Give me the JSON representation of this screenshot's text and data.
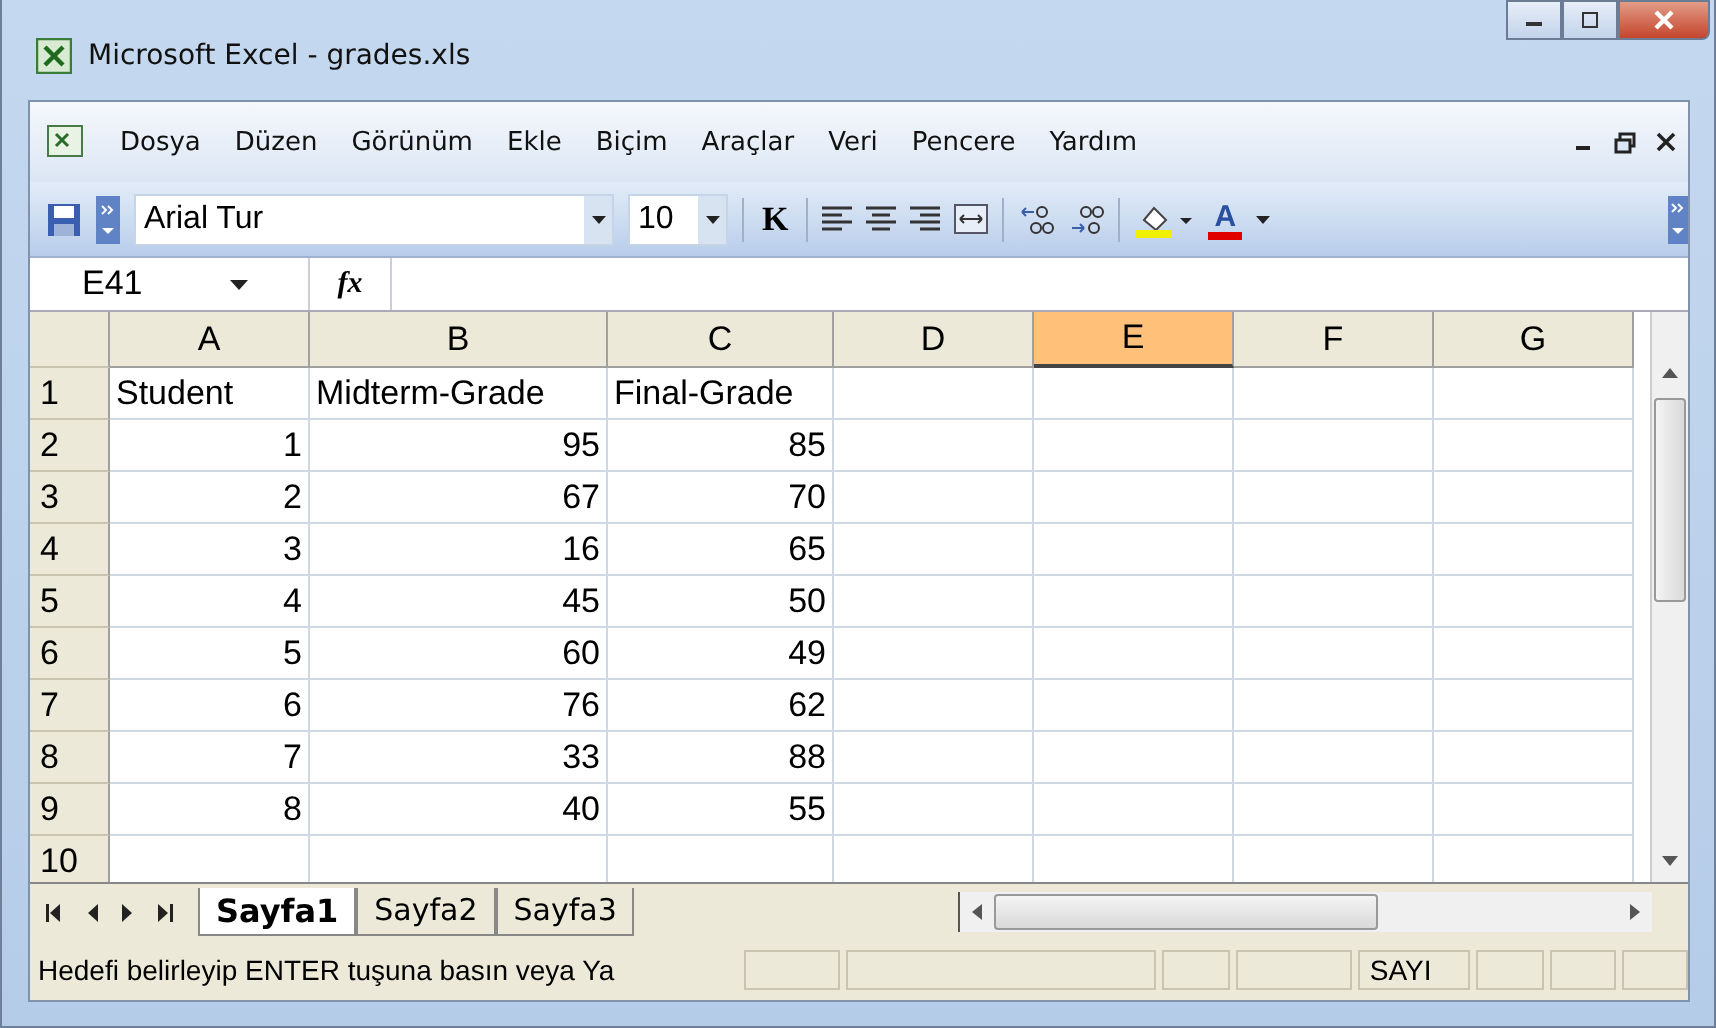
{
  "window": {
    "title": "Microsoft Excel - grades.xls"
  },
  "menu": [
    {
      "label": "Dosya"
    },
    {
      "label": "Düzen"
    },
    {
      "label": "Görünüm"
    },
    {
      "label": "Ekle"
    },
    {
      "label": "Biçim"
    },
    {
      "label": "Araçlar"
    },
    {
      "label": "Veri"
    },
    {
      "label": "Pencere"
    },
    {
      "label": "Yardım"
    }
  ],
  "toolbar": {
    "font": "Arial Tur",
    "size": "10",
    "bold_label": "K",
    "font_color_label": "A"
  },
  "formula_bar": {
    "name_box": "E41",
    "fx": "fx"
  },
  "columns": [
    {
      "label": "A",
      "selected": false
    },
    {
      "label": "B",
      "selected": false
    },
    {
      "label": "C",
      "selected": false
    },
    {
      "label": "D",
      "selected": false
    },
    {
      "label": "E",
      "selected": true
    },
    {
      "label": "F",
      "selected": false
    },
    {
      "label": "G",
      "selected": false
    }
  ],
  "rows": [
    {
      "header": "1",
      "cells": [
        {
          "text": "Student",
          "kind": "text"
        },
        {
          "text": "Midterm-Grade",
          "kind": "text"
        },
        {
          "text": "Final-Grade",
          "kind": "text"
        }
      ]
    },
    {
      "header": "2",
      "cells": [
        {
          "text": "1",
          "kind": "number"
        },
        {
          "text": "95",
          "kind": "number"
        },
        {
          "text": "85",
          "kind": "number"
        }
      ]
    },
    {
      "header": "3",
      "cells": [
        {
          "text": "2",
          "kind": "number"
        },
        {
          "text": "67",
          "kind": "number"
        },
        {
          "text": "70",
          "kind": "number"
        }
      ]
    },
    {
      "header": "4",
      "cells": [
        {
          "text": "3",
          "kind": "number"
        },
        {
          "text": "16",
          "kind": "number"
        },
        {
          "text": "65",
          "kind": "number"
        }
      ]
    },
    {
      "header": "5",
      "cells": [
        {
          "text": "4",
          "kind": "number"
        },
        {
          "text": "45",
          "kind": "number"
        },
        {
          "text": "50",
          "kind": "number"
        }
      ]
    },
    {
      "header": "6",
      "cells": [
        {
          "text": "5",
          "kind": "number"
        },
        {
          "text": "60",
          "kind": "number"
        },
        {
          "text": "49",
          "kind": "number"
        }
      ]
    },
    {
      "header": "7",
      "cells": [
        {
          "text": "6",
          "kind": "number"
        },
        {
          "text": "76",
          "kind": "number"
        },
        {
          "text": "62",
          "kind": "number"
        }
      ]
    },
    {
      "header": "8",
      "cells": [
        {
          "text": "7",
          "kind": "number"
        },
        {
          "text": "33",
          "kind": "number"
        },
        {
          "text": "88",
          "kind": "number"
        }
      ]
    },
    {
      "header": "9",
      "cells": [
        {
          "text": "8",
          "kind": "number"
        },
        {
          "text": "40",
          "kind": "number"
        },
        {
          "text": "55",
          "kind": "number"
        }
      ]
    },
    {
      "header": "10",
      "cells": []
    }
  ],
  "sheet_tabs": [
    {
      "label": "Sayfa1",
      "selected": true
    },
    {
      "label": "Sayfa2",
      "selected": false
    },
    {
      "label": "Sayfa3",
      "selected": false
    }
  ],
  "status_bar": {
    "message": "Hedefi belirleyip ENTER tuşuna basın veya Ya",
    "mode": "SAYI"
  }
}
